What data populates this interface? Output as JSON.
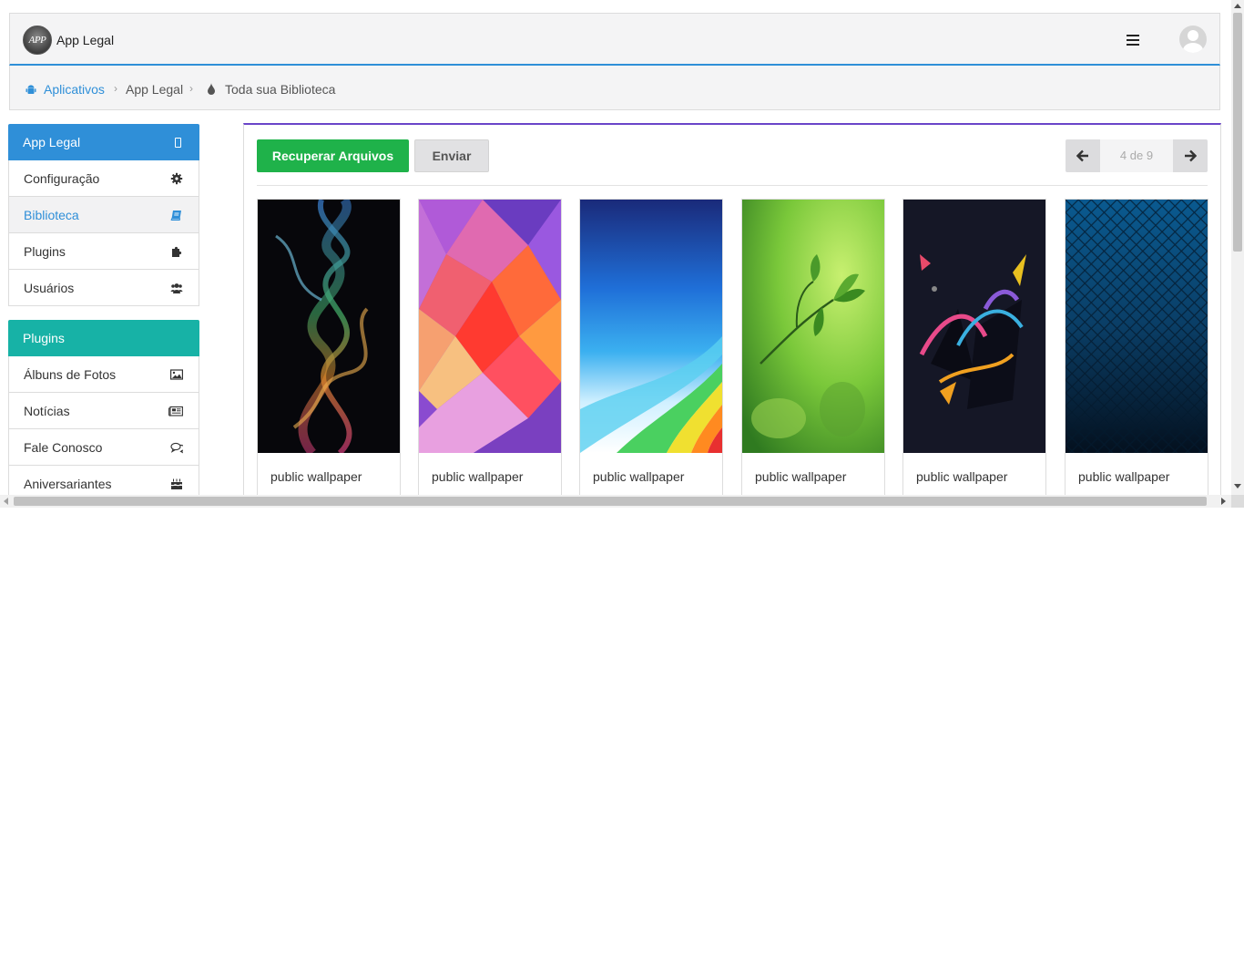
{
  "header": {
    "logo_text": "APP",
    "app_title": "App Legal"
  },
  "breadcrumb": {
    "items": [
      "Aplicativos",
      "App Legal",
      "Toda sua Biblioteca"
    ],
    "separator": "›"
  },
  "sidebar": {
    "app_panel": {
      "title": "App Legal",
      "color": "#2f8fd8",
      "items": [
        {
          "label": "Configuração",
          "icon": "gear-icon"
        },
        {
          "label": "Biblioteca",
          "icon": "book-icon",
          "active": true
        },
        {
          "label": "Plugins",
          "icon": "puzzle-icon"
        },
        {
          "label": "Usuários",
          "icon": "users-icon"
        }
      ]
    },
    "plugins_panel": {
      "title": "Plugins",
      "color": "#17b2a6",
      "items": [
        {
          "label": "Álbuns de Fotos",
          "icon": "image-icon"
        },
        {
          "label": "Notícias",
          "icon": "newspaper-icon"
        },
        {
          "label": "Fale Conosco",
          "icon": "chat-icon"
        },
        {
          "label": "Aniversariantes",
          "icon": "birthday-cake-icon"
        }
      ]
    }
  },
  "toolbar": {
    "recover_label": "Recuperar Arquivos",
    "send_label": "Enviar",
    "pager_status": "4 de 9"
  },
  "gallery": {
    "items": [
      {
        "label": "public wallpaper",
        "image": "smoke-wallpaper"
      },
      {
        "label": "public wallpaper",
        "image": "polygon-wallpaper"
      },
      {
        "label": "public wallpaper",
        "image": "rainbow-wave-wallpaper"
      },
      {
        "label": "public wallpaper",
        "image": "green-leaf-wallpaper"
      },
      {
        "label": "public wallpaper",
        "image": "abstract-dark-wallpaper"
      },
      {
        "label": "public wallpaper",
        "image": "blue-mosaic-wallpaper"
      }
    ]
  },
  "colors": {
    "primary": "#2f8fd8",
    "success": "#1fb24a",
    "teal": "#17b2a6",
    "card_accent": "#6a45c9"
  }
}
